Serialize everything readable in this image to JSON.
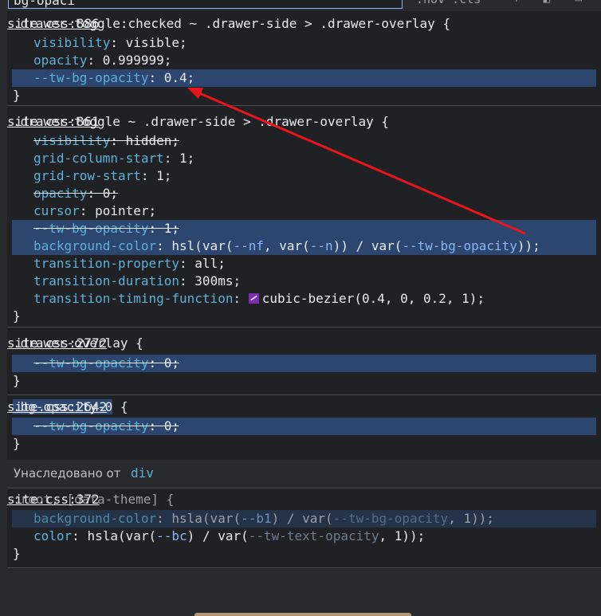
{
  "filter": {
    "query": "bg-opaci",
    "flags_label": ":hov .cls"
  },
  "rules": [
    {
      "selector": ".drawer-toggle:checked ~ .drawer-side > .drawer-overlay {",
      "source": "site.css:886",
      "decls": [
        {
          "prop": "visibility",
          "value": "visible;"
        },
        {
          "prop": "opacity",
          "value": "0.999999;"
        },
        {
          "prop": "--tw-bg-opacity",
          "value": "0.4;"
        }
      ]
    },
    {
      "selector": ".drawer-toggle ~ .drawer-side > .drawer-overlay {",
      "source": "site.css:861",
      "decls": [
        {
          "prop": "visibility",
          "value": "hidden;"
        },
        {
          "prop": "grid-column-start",
          "value": "1;"
        },
        {
          "prop": "grid-row-start",
          "value": "1;"
        },
        {
          "prop": "opacity",
          "value": "0;"
        },
        {
          "prop": "cursor",
          "value": "pointer;"
        },
        {
          "prop": "--tw-bg-opacity",
          "value": "1;"
        },
        {
          "prop": "background-color",
          "v1": "hsl(var(",
          "vv1": "--nf",
          "v2": ", var(",
          "vv2": "--n",
          "v3": ")) / var(",
          "vv3": "--tw-bg-opacity",
          "v4": "));"
        },
        {
          "prop": "transition-property",
          "value": "all;"
        },
        {
          "prop": "transition-duration",
          "value": "300ms;"
        },
        {
          "prop": "transition-timing-function",
          "value": "cubic-bezier(0.4, 0, 0.2, 1);"
        }
      ]
    },
    {
      "selector": ".drawer-overlay {",
      "source": "site.css:2772",
      "decls": [
        {
          "prop": "--tw-bg-opacity",
          "value": "0;"
        }
      ]
    },
    {
      "selector_hl": ".bg-opacity-0",
      "selector_rest": " {",
      "source": "site.css:2642",
      "decls": [
        {
          "prop": "--tw-bg-opacity",
          "value": "0;"
        }
      ]
    },
    {
      "selector": ":root, [data-theme] {",
      "source": "site.css:372",
      "decls": [
        {
          "prop": "background-color",
          "v1": "hsla(var(",
          "vv1": "--b1",
          "v2": ") / var(",
          "vv2": "--tw-bg-opacity",
          "v3": ", 1));"
        },
        {
          "prop": "color",
          "v1": "hsla(var(",
          "vv1": "--bc",
          "v2": ") / var(",
          "vv2": "--tw-text-opacity",
          "v3": ", 1));"
        }
      ]
    }
  ],
  "brace_close": "}",
  "colon": ": ",
  "inherited": {
    "label": "Унаследовано от",
    "tag": "div"
  },
  "colors": {
    "highlight": "#2c4670",
    "property": "#5db0d7",
    "annotation_arrow": "#e8161b"
  }
}
